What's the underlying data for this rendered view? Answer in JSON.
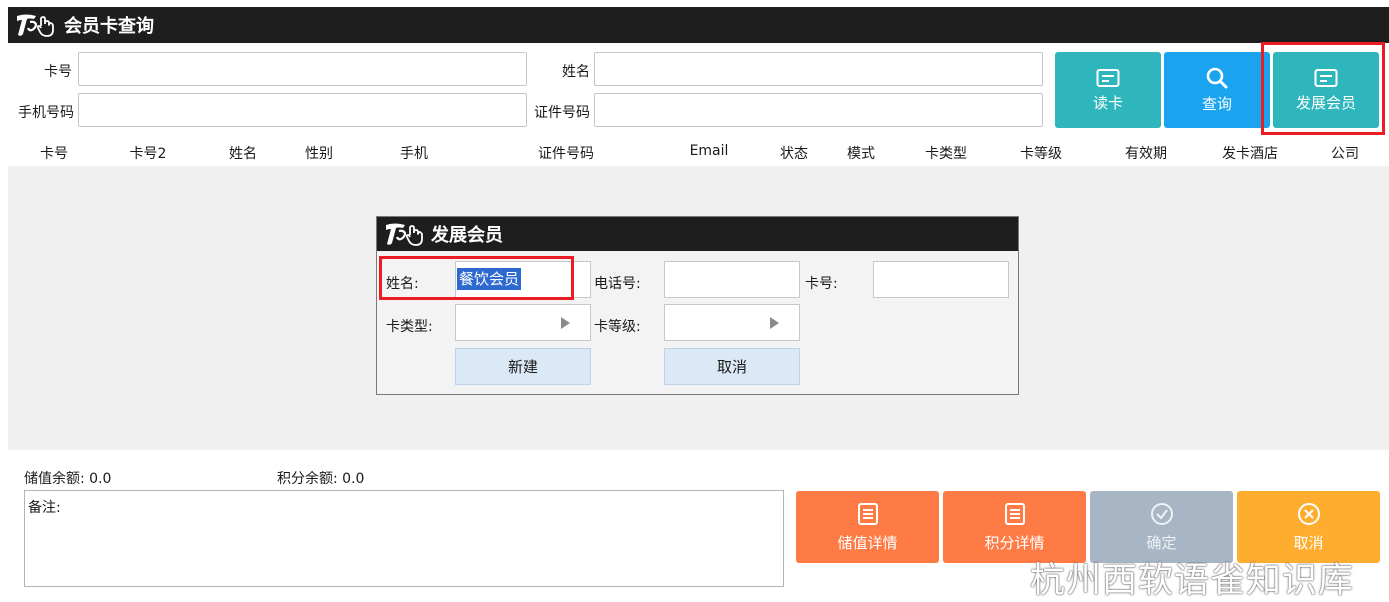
{
  "window": {
    "title": "会员卡查询"
  },
  "search": {
    "card_no_label": "卡号",
    "name_label": "姓名",
    "phone_label": "手机号码",
    "id_label": "证件号码",
    "card_no_value": "",
    "name_value": "",
    "phone_value": "",
    "id_value": ""
  },
  "toolbar": {
    "read_card": "读卡",
    "query": "查询",
    "new_member": "发展会员"
  },
  "table": {
    "columns": [
      "卡号",
      "卡号2",
      "姓名",
      "性别",
      "手机",
      "证件号码",
      "Email",
      "状态",
      "模式",
      "卡类型",
      "卡等级",
      "有效期",
      "发卡酒店",
      "公司"
    ]
  },
  "dialog": {
    "title": "发展会员",
    "name_label": "姓名:",
    "name_value": "餐饮会员",
    "phone_label": "电话号:",
    "phone_value": "",
    "card_label": "卡号:",
    "card_value": "",
    "card_type_label": "卡类型:",
    "card_type_value": "",
    "card_level_label": "卡等级:",
    "card_level_value": "",
    "create_label": "新建",
    "cancel_label": "取消"
  },
  "summary": {
    "stored_balance": "储值余额: 0.0",
    "points_balance": "积分余额: 0.0",
    "remark_label": "备注:"
  },
  "actions": {
    "stored_detail": "储值详情",
    "points_detail": "积分详情",
    "confirm": "确定",
    "cancel": "取消"
  },
  "watermark": "杭州西软语雀知识库",
  "colors": {
    "teal": "#2eb6bc",
    "blue": "#1aa3ee",
    "orange": "#ff7b45",
    "gray": "#a7b5c5",
    "yellow": "#ffad2e",
    "highlight": "#ec1c24"
  }
}
